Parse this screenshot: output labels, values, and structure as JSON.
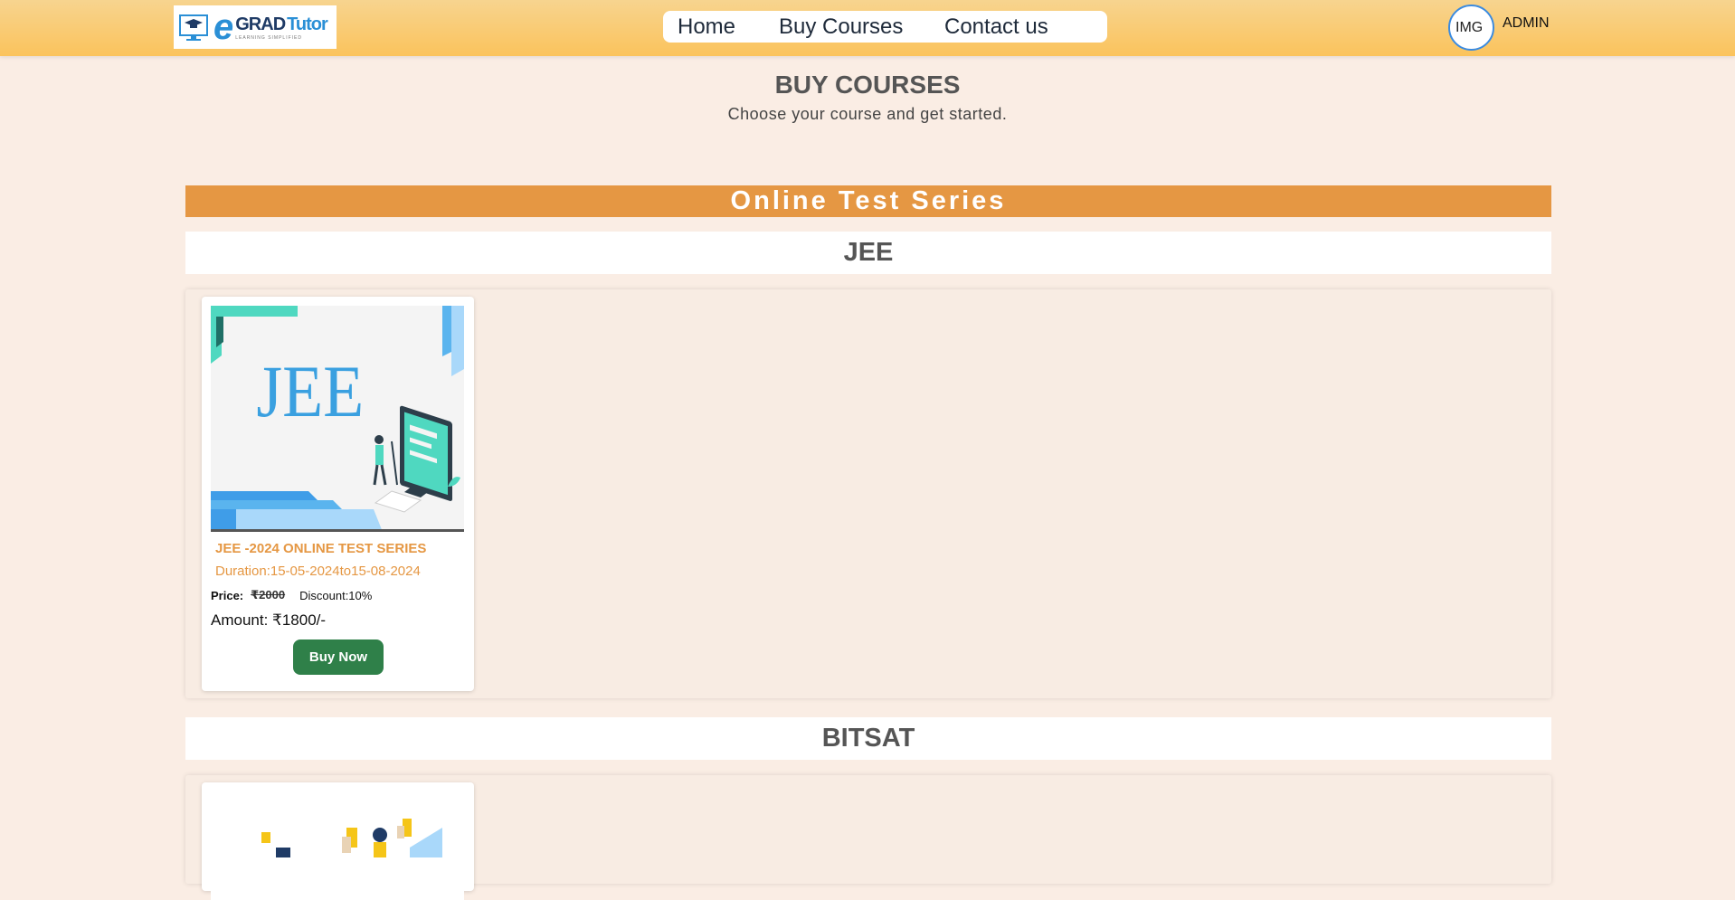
{
  "header": {
    "logo": {
      "e": "e",
      "grad": "GRAD",
      "tutor": "Tutor",
      "tagline": "LEARNING SIMPLIFIED"
    },
    "nav": [
      {
        "label": "Home"
      },
      {
        "label": "Buy Courses"
      },
      {
        "label": "Contact us"
      }
    ],
    "avatar_alt": "IMG",
    "user": "ADMIN"
  },
  "page": {
    "title": "BUY COURSES",
    "subtitle": "Choose your course and get started."
  },
  "section": {
    "title": "Online Test Series",
    "categories": [
      {
        "name": "JEE",
        "courses": [
          {
            "image_text": "JEE",
            "title": "JEE -2024 ONLINE TEST SERIES",
            "duration": "Duration:15-05-2024to15-08-2024",
            "price_label": "Price:",
            "price": "₹2000",
            "discount": "Discount:10%",
            "amount": "Amount: ₹1800/-",
            "button": "Buy Now"
          }
        ]
      },
      {
        "name": "BITSAT",
        "courses": []
      }
    ]
  },
  "colors": {
    "accent": "#e59743",
    "button": "#2f8049",
    "background": "#faede4"
  }
}
